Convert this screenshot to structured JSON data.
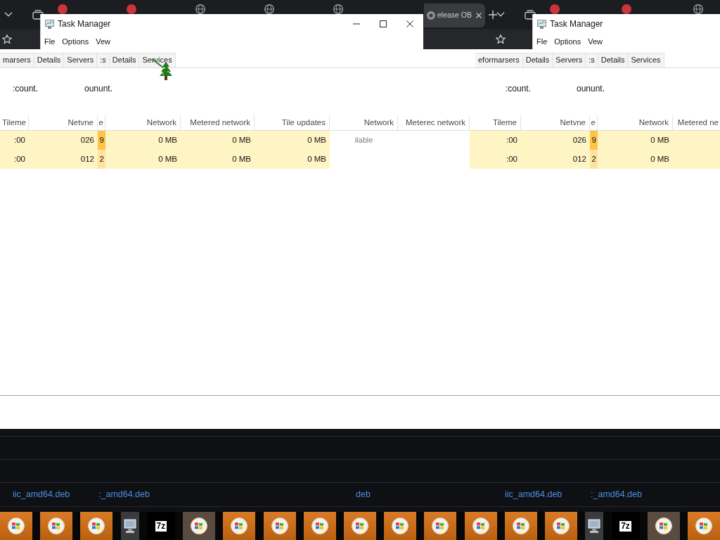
{
  "browser": {
    "strips": [
      {
        "tabs": [
          {
            "kind": "dot",
            "selected": false
          },
          {
            "kind": "dot",
            "selected": false
          },
          {
            "kind": "globe",
            "selected": false
          },
          {
            "kind": "globe",
            "selected": false
          },
          {
            "kind": "globe",
            "selected": false
          },
          {
            "kind": "circle",
            "title": "elease OB",
            "selected": true
          }
        ],
        "new_tab": true
      },
      {
        "tabs": [
          {
            "kind": "dot",
            "selected": false
          },
          {
            "kind": "dot",
            "selected": false
          },
          {
            "kind": "globe",
            "selected": false
          }
        ],
        "new_tab": false
      }
    ]
  },
  "windows": [
    {
      "title": "Task Manager",
      "menu": [
        "Fle",
        "Options",
        "Vew"
      ],
      "caption_buttons": true
    },
    {
      "title": "Task Manager",
      "menu": [
        "Fle",
        "Options",
        "Vew"
      ],
      "caption_buttons": false
    }
  ],
  "tab_strips": [
    {
      "tabs": [
        "marsers",
        "Details",
        "Servers",
        ":s",
        "Details",
        "Services"
      ]
    },
    {
      "tabs": [
        "eformarsers",
        "Details",
        "Servers",
        ":s",
        "Details",
        "Services"
      ]
    }
  ],
  "summary": [
    ":count.",
    "oununt.",
    ":count.",
    "oununt."
  ],
  "table": {
    "columns": [
      "Tileme",
      "Netvne",
      "e",
      "Network",
      "Metered network",
      "Tile updates",
      "Network",
      "Meterec network",
      "Tileme",
      "Netvne",
      "e",
      "Network",
      "Metered ne"
    ],
    "rows": [
      {
        "cells": [
          {
            "text": ":00",
            "color": "#fff4c4"
          },
          {
            "text": "026",
            "color": "#fff4c4"
          },
          {
            "text": "9",
            "color": "#ffc445"
          },
          {
            "text": "0 MB",
            "color": "#fff4c4"
          },
          {
            "text": "0 MB",
            "color": "#fff4c4"
          },
          {
            "text": "0 MB",
            "color": "#fff4c4"
          },
          {
            "text": "ilable"
          },
          {},
          {
            "text": ":00",
            "color": "#fff4c4"
          },
          {
            "text": "026",
            "color": "#fff4c4"
          },
          {
            "text": "9",
            "color": "#ffc445"
          },
          {
            "text": "0 MB",
            "color": "#fff4c4"
          },
          {
            "color": "#fff4c4"
          }
        ]
      },
      {
        "cells": [
          {
            "text": ":00",
            "color": "#fff4c4"
          },
          {
            "text": "012",
            "color": "#fff4c4"
          },
          {
            "text": "2",
            "color": "#ffe3a0"
          },
          {
            "text": "0 MB",
            "color": "#fff4c4"
          },
          {
            "text": "0 MB",
            "color": "#fff4c4"
          },
          {
            "text": "0 MB",
            "color": "#fff4c4"
          },
          {},
          {},
          {
            "text": ":00",
            "color": "#fff4c4"
          },
          {
            "text": "012",
            "color": "#fff4c4"
          },
          {
            "text": "2",
            "color": "#ffe3a0"
          },
          {
            "text": "0 MB",
            "color": "#fff4c4"
          },
          {
            "color": "#fff4c4"
          }
        ]
      }
    ]
  },
  "downloads": [
    "iic_amd64.deb",
    ":_amd64.deb",
    "deb",
    "iic_amd64.deb",
    ":_amd64.deb"
  ],
  "taskbar": [
    {
      "kind": "logo",
      "highlighted": true
    },
    {
      "kind": "logo",
      "highlighted": true
    },
    {
      "kind": "logo",
      "highlighted": true
    },
    {
      "kind": "computer",
      "highlighted": false
    },
    {
      "kind": "archive",
      "label": "7z",
      "highlighted": false
    },
    {
      "kind": "logo",
      "highlighted": false
    },
    {
      "kind": "logo",
      "highlighted": true
    },
    {
      "kind": "logo",
      "highlighted": true
    },
    {
      "kind": "logo",
      "highlighted": true
    },
    {
      "kind": "logo",
      "highlighted": true
    },
    {
      "kind": "logo",
      "highlighted": true
    },
    {
      "kind": "logo",
      "highlighted": true
    },
    {
      "kind": "logo",
      "highlighted": true
    },
    {
      "kind": "logo",
      "highlighted": true
    },
    {
      "kind": "logo",
      "highlighted": true
    },
    {
      "kind": "computer",
      "highlighted": false
    },
    {
      "kind": "archive",
      "label": "7z",
      "highlighted": false
    },
    {
      "kind": "logo",
      "highlighted": false
    },
    {
      "kind": "logo",
      "highlighted": true
    }
  ]
}
